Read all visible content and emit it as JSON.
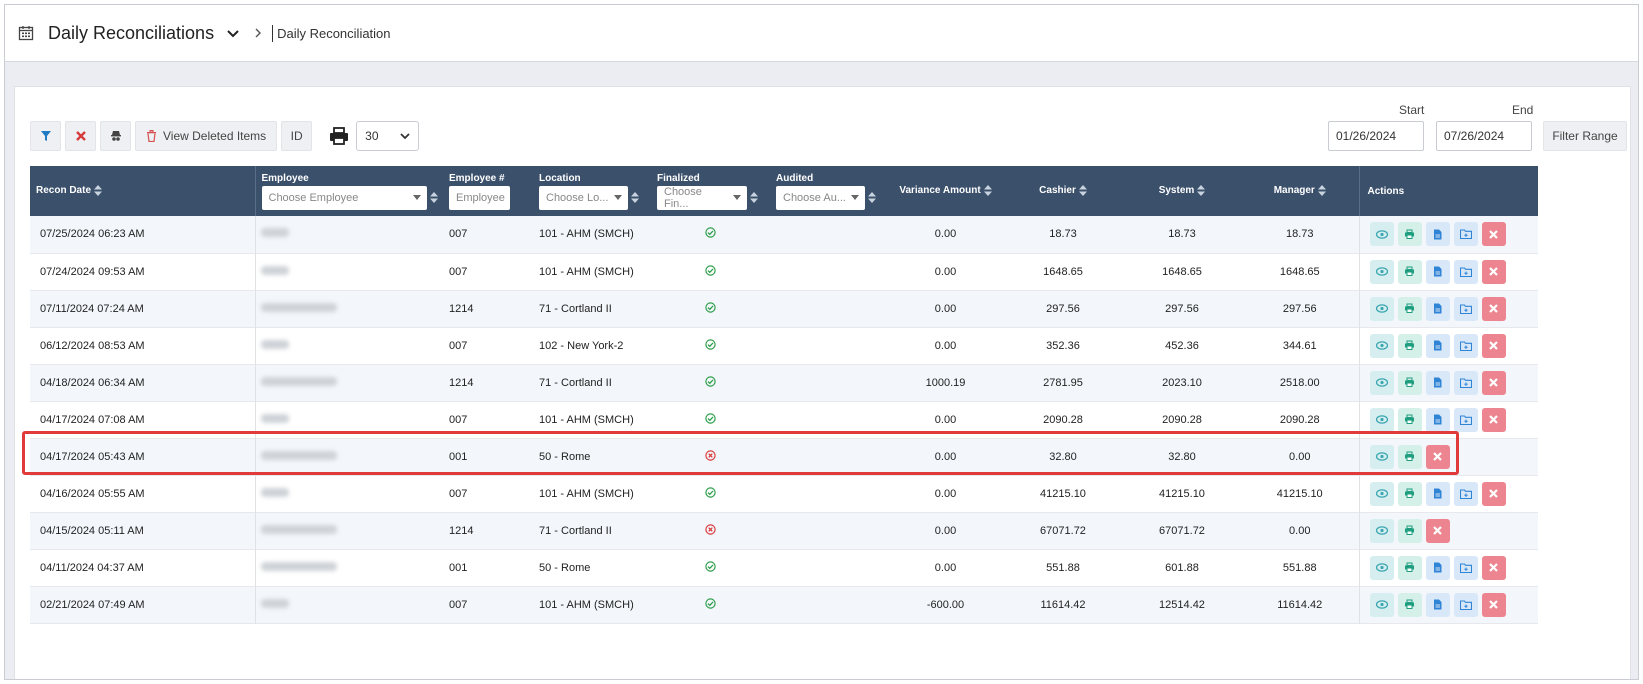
{
  "breadcrumb": {
    "title": "Daily Reconciliations",
    "current": "Daily Reconciliation"
  },
  "toolbar": {
    "view_deleted_label": "View Deleted Items",
    "id_label": "ID",
    "page_size": "30"
  },
  "range": {
    "start_label": "Start",
    "end_label": "End",
    "start_value": "01/26/2024",
    "end_value": "07/26/2024",
    "filter_label": "Filter Range"
  },
  "columns": {
    "recon_date": "Recon Date",
    "employee": "Employee",
    "employee_placeholder": "Choose Employee",
    "employee_num": "Employee #",
    "employee_num_placeholder": "Employee",
    "location": "Location",
    "location_placeholder": "Choose Lo...",
    "finalized": "Finalized",
    "finalized_placeholder": "Choose Fin...",
    "audited": "Audited",
    "audited_placeholder": "Choose Au...",
    "variance": "Variance Amount",
    "cashier": "Cashier",
    "system": "System",
    "manager": "Manager",
    "actions": "Actions"
  },
  "colors": {
    "header_bg": "#3a506b",
    "finalized_yes": "#2e9e4a",
    "finalized_no": "#d93a3a",
    "delete_btn": "#ec8590",
    "highlight": "#e03a3a"
  },
  "rows": [
    {
      "date": "07/25/2024 06:23 AM",
      "emp_num": "007",
      "location": "101 - AHM (SMCH)",
      "finalized": true,
      "variance": "0.00",
      "cashier": "18.73",
      "system": "18.73",
      "manager": "18.73",
      "full_actions": true
    },
    {
      "date": "07/24/2024 09:53 AM",
      "emp_num": "007",
      "location": "101 - AHM (SMCH)",
      "finalized": true,
      "variance": "0.00",
      "cashier": "1648.65",
      "system": "1648.65",
      "manager": "1648.65",
      "full_actions": true
    },
    {
      "date": "07/11/2024 07:24 AM",
      "emp_num": "1214",
      "location": "71 - Cortland II",
      "finalized": true,
      "variance": "0.00",
      "cashier": "297.56",
      "system": "297.56",
      "manager": "297.56",
      "full_actions": true
    },
    {
      "date": "06/12/2024 08:53 AM",
      "emp_num": "007",
      "location": "102 - New York-2",
      "finalized": true,
      "variance": "0.00",
      "cashier": "352.36",
      "system": "452.36",
      "manager": "344.61",
      "full_actions": true
    },
    {
      "date": "04/18/2024 06:34 AM",
      "emp_num": "1214",
      "location": "71 - Cortland II",
      "finalized": true,
      "variance": "1000.19",
      "cashier": "2781.95",
      "system": "2023.10",
      "manager": "2518.00",
      "full_actions": true
    },
    {
      "date": "04/17/2024 07:08 AM",
      "emp_num": "007",
      "location": "101 - AHM (SMCH)",
      "finalized": true,
      "variance": "0.00",
      "cashier": "2090.28",
      "system": "2090.28",
      "manager": "2090.28",
      "full_actions": true
    },
    {
      "date": "04/17/2024 05:43 AM",
      "emp_num": "001",
      "location": "50 - Rome",
      "finalized": false,
      "variance": "0.00",
      "cashier": "32.80",
      "system": "32.80",
      "manager": "0.00",
      "full_actions": false
    },
    {
      "date": "04/16/2024 05:55 AM",
      "emp_num": "007",
      "location": "101 - AHM (SMCH)",
      "finalized": true,
      "variance": "0.00",
      "cashier": "41215.10",
      "system": "41215.10",
      "manager": "41215.10",
      "full_actions": true
    },
    {
      "date": "04/15/2024 05:11 AM",
      "emp_num": "1214",
      "location": "71 - Cortland II",
      "finalized": false,
      "variance": "0.00",
      "cashier": "67071.72",
      "system": "67071.72",
      "manager": "0.00",
      "full_actions": false
    },
    {
      "date": "04/11/2024 04:37 AM",
      "emp_num": "001",
      "location": "50 - Rome",
      "finalized": true,
      "variance": "0.00",
      "cashier": "551.88",
      "system": "601.88",
      "manager": "551.88",
      "full_actions": true
    },
    {
      "date": "02/21/2024 07:49 AM",
      "emp_num": "007",
      "location": "101 - AHM (SMCH)",
      "finalized": true,
      "variance": "-600.00",
      "cashier": "11614.42",
      "system": "12514.42",
      "manager": "11614.42",
      "full_actions": true
    }
  ]
}
